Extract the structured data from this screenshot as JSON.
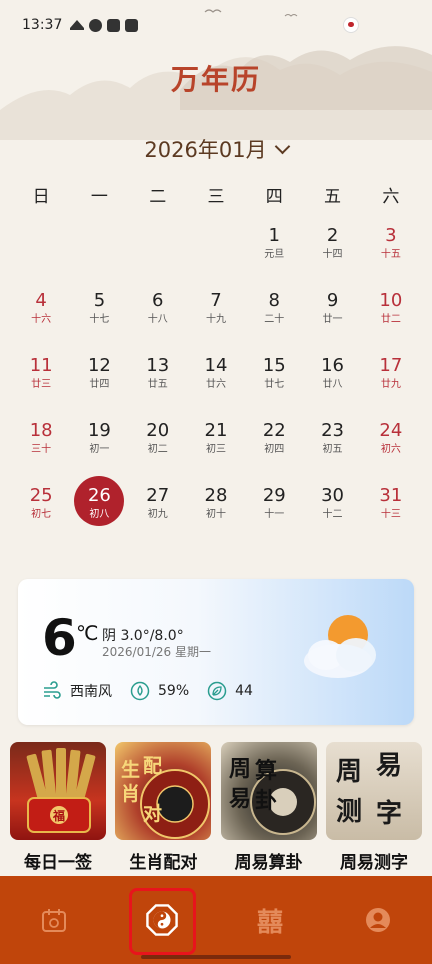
{
  "status_bar": {
    "time": "13:37"
  },
  "app": {
    "title": "万年历"
  },
  "month_selector": {
    "label": "2026年01月"
  },
  "weekdays": [
    "日",
    "一",
    "二",
    "三",
    "四",
    "五",
    "六"
  ],
  "calendar_weeks": [
    [
      {
        "d": "",
        "l": ""
      },
      {
        "d": "",
        "l": ""
      },
      {
        "d": "",
        "l": ""
      },
      {
        "d": "",
        "l": ""
      },
      {
        "d": "1",
        "l": "元旦"
      },
      {
        "d": "2",
        "l": "十四"
      },
      {
        "d": "3",
        "l": "十五"
      }
    ],
    [
      {
        "d": "4",
        "l": "十六"
      },
      {
        "d": "5",
        "l": "十七"
      },
      {
        "d": "6",
        "l": "十八"
      },
      {
        "d": "7",
        "l": "十九"
      },
      {
        "d": "8",
        "l": "二十"
      },
      {
        "d": "9",
        "l": "廿一"
      },
      {
        "d": "10",
        "l": "廿二"
      }
    ],
    [
      {
        "d": "11",
        "l": "廿三"
      },
      {
        "d": "12",
        "l": "廿四"
      },
      {
        "d": "13",
        "l": "廿五"
      },
      {
        "d": "14",
        "l": "廿六"
      },
      {
        "d": "15",
        "l": "廿七"
      },
      {
        "d": "16",
        "l": "廿八"
      },
      {
        "d": "17",
        "l": "廿九"
      }
    ],
    [
      {
        "d": "18",
        "l": "三十"
      },
      {
        "d": "19",
        "l": "初一"
      },
      {
        "d": "20",
        "l": "初二"
      },
      {
        "d": "21",
        "l": "初三"
      },
      {
        "d": "22",
        "l": "初四"
      },
      {
        "d": "23",
        "l": "初五"
      },
      {
        "d": "24",
        "l": "初六"
      }
    ],
    [
      {
        "d": "25",
        "l": "初七"
      },
      {
        "d": "26",
        "l": "初八"
      },
      {
        "d": "27",
        "l": "初九"
      },
      {
        "d": "28",
        "l": "初十"
      },
      {
        "d": "29",
        "l": "十一"
      },
      {
        "d": "30",
        "l": "十二"
      },
      {
        "d": "31",
        "l": "十三"
      }
    ]
  ],
  "selected_day": "26",
  "weather": {
    "temperature": "6",
    "unit": "℃",
    "condition": "阴 3.0°/8.0°",
    "date": "2026/01/26 星期一",
    "wind": "西南风",
    "humidity": "59%",
    "aqi": "44"
  },
  "features": [
    {
      "name": "每日一签",
      "art_text": "福"
    },
    {
      "name": "生肖配对",
      "art_text": "生肖配对"
    },
    {
      "name": "周易算卦",
      "art_text": "周易算卦"
    },
    {
      "name": "周易测字",
      "art_text": "周易测字"
    }
  ],
  "bottom_nav": [
    {
      "name": "calendar",
      "icon": "calendar-icon"
    },
    {
      "name": "yinyang",
      "icon": "bagua-icon",
      "selected": true
    },
    {
      "name": "double-happiness",
      "icon": "double-happiness-icon",
      "glyph": "囍"
    },
    {
      "name": "profile",
      "icon": "person-icon"
    }
  ],
  "colors": {
    "accent": "#c0450b",
    "title": "#b8442a",
    "weekend": "#b8303a",
    "today": "#b0222c",
    "highlight_box": "#e8141c"
  }
}
